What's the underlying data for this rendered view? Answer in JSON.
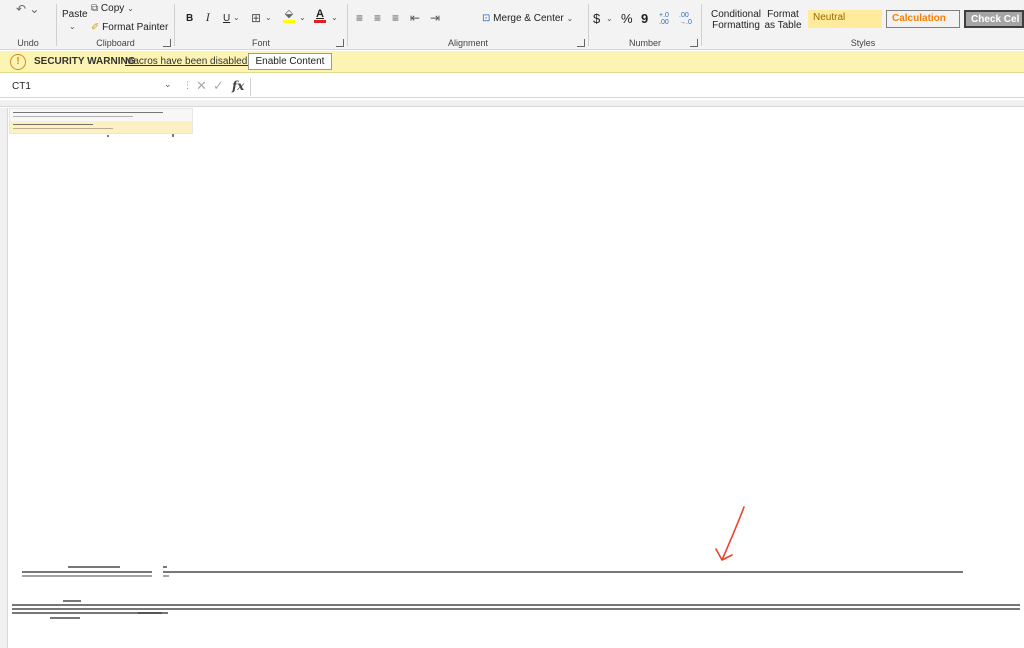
{
  "ribbon": {
    "undo": {
      "label": "Undo"
    },
    "clipboard": {
      "label": "Clipboard",
      "paste": "Paste",
      "copy": "Copy",
      "format_painter": "Format Painter"
    },
    "font": {
      "label": "Font",
      "bold": "B",
      "italic": "I",
      "underline": "U"
    },
    "alignment": {
      "label": "Alignment",
      "merge_center": "Merge & Center"
    },
    "number": {
      "label": "Number",
      "currency": "$",
      "percent": "%",
      "comma": "9",
      "increase_decimal": "+.0 .00",
      "decrease_decimal": ".00 →.0"
    },
    "styles": {
      "label": "Styles",
      "conditional_formatting": "Conditional Formatting",
      "format_as_table": "Format as Table",
      "cells": [
        {
          "label": "Neutral",
          "bg": "#ffeb9c",
          "fg": "#9c6500"
        },
        {
          "label": "Calculation",
          "bg": "#f2f2f2",
          "fg": "#fa7d00"
        },
        {
          "label": "Check Cel",
          "bg": "#a5a5a5",
          "fg": "#ffffff"
        }
      ]
    }
  },
  "security": {
    "title": "SECURITY WARNING",
    "message": "Macros have been disabled.",
    "enable_button": "Enable Content"
  },
  "formula_bar": {
    "name_box": "CT1",
    "fx": "fx",
    "cancel": "✕",
    "enter": "✓"
  },
  "colors": {
    "ribbon_bg": "#f3f3f3",
    "security_bg": "#fcf4b3",
    "annotation_arrow": "#e8452c"
  }
}
